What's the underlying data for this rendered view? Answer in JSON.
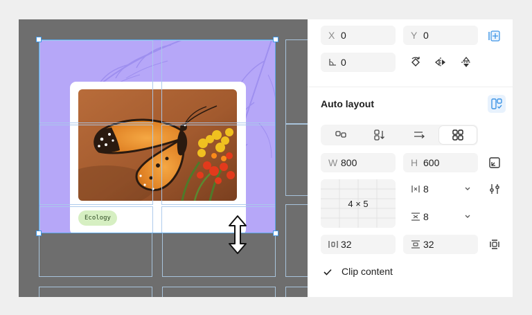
{
  "canvas": {
    "frame_tag": "Ecology"
  },
  "panel": {
    "position": {
      "x": {
        "label": "X",
        "value": "0"
      },
      "y": {
        "label": "Y",
        "value": "0"
      },
      "rotation": {
        "value": "0"
      }
    },
    "auto_layout": {
      "title": "Auto layout",
      "width": {
        "label": "W",
        "value": "800"
      },
      "height": {
        "label": "H",
        "value": "600"
      },
      "grid": {
        "label": "4 × 5"
      },
      "horizontal_gap": "8",
      "vertical_gap": "8",
      "horizontal_padding": "32",
      "vertical_padding": "32",
      "clip_content": "Clip content"
    }
  },
  "colors": {
    "frame_fill": "#b6a7f8",
    "selection": "#3d95e6",
    "canvas": "#6e6e6e",
    "tag_fill": "#d6efc2"
  }
}
